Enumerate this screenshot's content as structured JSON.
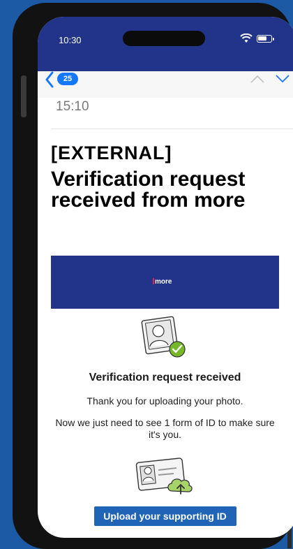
{
  "status_bar": {
    "time": "10:30"
  },
  "mail_nav": {
    "unread_count": "25"
  },
  "email": {
    "received_time": "15:10",
    "tag": "[EXTERNAL]",
    "subject": "Verification request received from more"
  },
  "body": {
    "brand_logo": "more",
    "heading": "Verification request received",
    "paragraph_1": "Thank you for uploading your photo.",
    "paragraph_2": "Now we just need to see 1 form of ID to make sure it's you.",
    "cta_label": "Upload your supporting ID"
  },
  "colors": {
    "brand_navy": "#21348a",
    "background_blue": "#1c5aa6",
    "badge_blue": "#1677ff",
    "button_blue": "#1f64b7",
    "logo_accent": "#e61f58",
    "check_green": "#76b82a"
  },
  "icons": [
    "wifi-icon",
    "battery-icon",
    "back-chevron-icon",
    "chevron-up-icon",
    "chevron-down-icon",
    "photo-verified-icon",
    "id-upload-icon"
  ]
}
